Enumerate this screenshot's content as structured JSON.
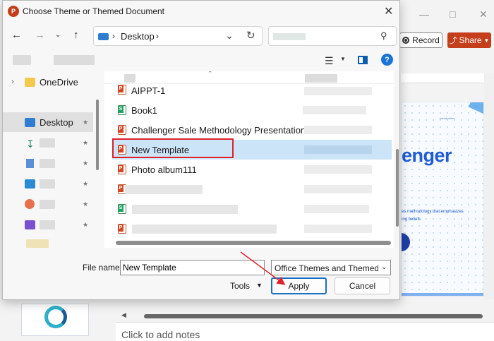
{
  "powerpoint": {
    "record_label": "Record",
    "share_label": "Share",
    "slide": {
      "title_fragment": "enger",
      "intro_text": "Introduction",
      "subtitle_line1": "es methodology that emphasizes",
      "subtitle_line2": "ing beliefs"
    },
    "notes_placeholder": "Click to add notes",
    "share_color": "#c43e1c"
  },
  "dialog": {
    "title": "Choose Theme or Themed Document",
    "address": {
      "location": "Desktop"
    },
    "nav_pane": {
      "items": [
        {
          "label": "OneDrive",
          "icon": "folder-icon"
        },
        {
          "label": "Desktop",
          "icon": "desktop-icon",
          "selected": true
        },
        {
          "label": "",
          "icon": "downloads-icon"
        },
        {
          "label": "",
          "icon": "documents-icon"
        },
        {
          "label": "",
          "icon": "pictures-icon"
        },
        {
          "label": "",
          "icon": "music-icon"
        },
        {
          "label": "",
          "icon": "videos-icon"
        }
      ]
    },
    "files": [
      {
        "name": "AIPPT-1",
        "type": "ppt"
      },
      {
        "name": "Book1",
        "type": "xls"
      },
      {
        "name": "Challenger Sale Methodology Presentation ...",
        "type": "ppt"
      },
      {
        "name": "New Template",
        "type": "ppt",
        "selected": true
      },
      {
        "name": "Photo album111",
        "type": "ppt"
      },
      {
        "name": "",
        "type": "ppt"
      },
      {
        "name": "",
        "type": "xls"
      },
      {
        "name": "",
        "type": "ppt"
      }
    ],
    "file_name_label": "File name:",
    "file_name_value": "New Template",
    "file_type_value": "Office Themes and Themed Documents",
    "tools_label": "Tools",
    "apply_label": "Apply",
    "cancel_label": "Cancel",
    "accent_color": "#1b6fbf",
    "highlight_color": "#e0212b"
  }
}
